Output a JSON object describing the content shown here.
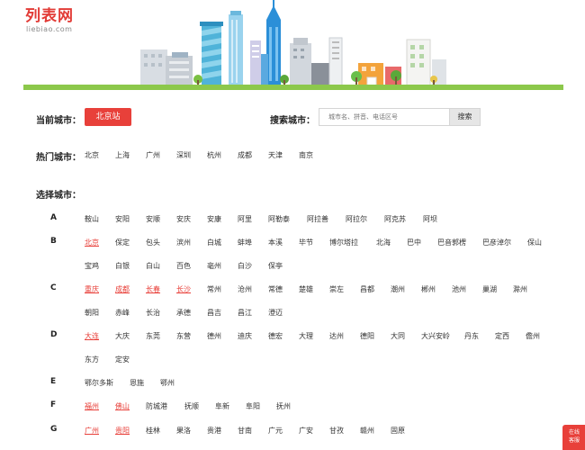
{
  "logo": {
    "main": "列表网",
    "sub": "liebiao.com"
  },
  "current_city": {
    "label": "当前城市：",
    "button": "北京站"
  },
  "search": {
    "label": "搜索城市：",
    "placeholder": "城市名、拼音、电话区号",
    "button": "搜索"
  },
  "hot_cities": {
    "label": "热门城市：",
    "items": [
      "北京",
      "上海",
      "广州",
      "深圳",
      "杭州",
      "成都",
      "天津",
      "南京"
    ]
  },
  "choose_city": {
    "label": "选择城市："
  },
  "groups": [
    {
      "letter": "A",
      "lines": [
        [
          "鞍山",
          "安阳",
          "安顺",
          "安庆",
          "安康",
          "阿里",
          "阿勒泰",
          "阿拉善",
          "阿拉尔",
          "阿克苏",
          "阿坝"
        ]
      ]
    },
    {
      "letter": "B",
      "lines": [
        [
          "北京",
          "保定",
          "包头",
          "滨州",
          "白城",
          "蚌埠",
          "本溪",
          "毕节",
          "博尔塔拉",
          "北海",
          "巴中",
          "巴音郭楞",
          "巴彦淖尔",
          "保山"
        ],
        [
          "宝鸡",
          "白银",
          "白山",
          "百色",
          "亳州",
          "白沙",
          "保亭"
        ]
      ]
    },
    {
      "letter": "C",
      "lines": [
        [
          "重庆",
          "成都",
          "长春",
          "长沙",
          "常州",
          "沧州",
          "常德",
          "楚雄",
          "崇左",
          "昌都",
          "潮州",
          "郴州",
          "池州",
          "巢湖",
          "滁州"
        ],
        [
          "朝阳",
          "赤峰",
          "长治",
          "承德",
          "昌吉",
          "昌江",
          "澄迈"
        ]
      ]
    },
    {
      "letter": "D",
      "lines": [
        [
          "大连",
          "大庆",
          "东莞",
          "东营",
          "德州",
          "迪庆",
          "德宏",
          "大理",
          "达州",
          "德阳",
          "大同",
          "大兴安岭",
          "丹东",
          "定西",
          "儋州"
        ],
        [
          "东方",
          "定安"
        ]
      ]
    },
    {
      "letter": "E",
      "lines": [
        [
          "鄂尔多斯",
          "恩施",
          "鄂州"
        ]
      ]
    },
    {
      "letter": "F",
      "lines": [
        [
          "福州",
          "佛山",
          "防城港",
          "抚顺",
          "阜新",
          "阜阳",
          "抚州"
        ]
      ]
    },
    {
      "letter": "G",
      "lines": [
        [
          "广州",
          "贵阳",
          "桂林",
          "果洛",
          "贵港",
          "甘南",
          "广元",
          "广安",
          "甘孜",
          "赣州",
          "固原"
        ]
      ]
    }
  ],
  "chat_widget": {
    "line1": "在线",
    "line2": "客服"
  },
  "colors": {
    "accent": "#e8403a",
    "ground": "#8cc84b"
  }
}
